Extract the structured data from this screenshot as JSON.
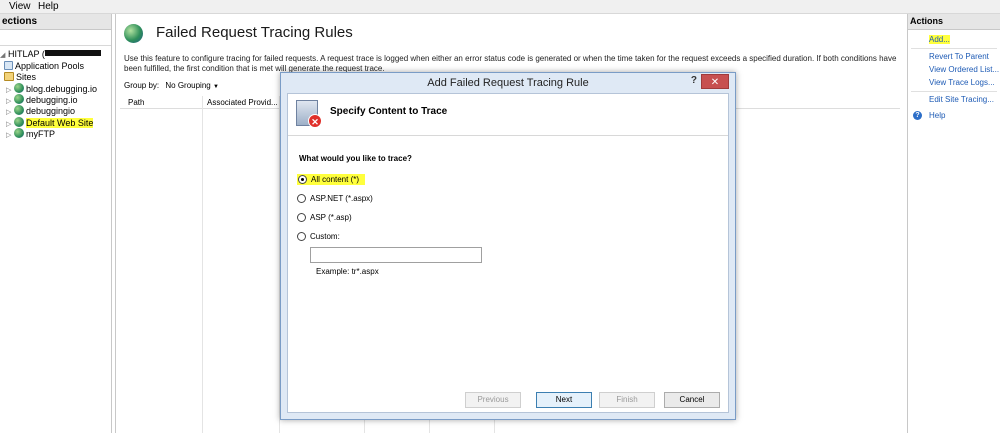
{
  "menu": {
    "view": "View",
    "help": "Help"
  },
  "left": {
    "header": "ections",
    "tree": [
      {
        "label": "HITLAP (",
        "icon": "server-icon"
      },
      {
        "label": "Application Pools",
        "icon": "app-pools-icon"
      },
      {
        "label": "Sites",
        "icon": "sites-folder-icon"
      },
      {
        "label": "blog.debugging.io",
        "icon": "globe-icon"
      },
      {
        "label": "debugging.io",
        "icon": "globe-icon"
      },
      {
        "label": "debuggingio",
        "icon": "globe-icon"
      },
      {
        "label": "Default Web Site",
        "icon": "globe-icon"
      },
      {
        "label": "myFTP",
        "icon": "globe-icon"
      }
    ]
  },
  "center": {
    "title": "Failed Request Tracing Rules",
    "description": "Use this feature to configure tracing for failed requests. A request trace is logged when either an error status code is generated or when the time taken for the request exceeds a specified duration. If both conditions have been fulfilled, the first condition that is met will generate the request trace.",
    "group_by_label": "Group by:",
    "group_by_value": "No Grouping",
    "columns": [
      "Path",
      "Associated Provid..."
    ]
  },
  "actions": {
    "header": "Actions",
    "items": [
      "Add...",
      "Revert To Parent",
      "View Ordered List...",
      "View Trace Logs...",
      "Edit Site Tracing...",
      "Help"
    ]
  },
  "dialog": {
    "title": "Add Failed Request Tracing Rule",
    "help_glyph": "?",
    "close_glyph": "✕",
    "step_title": "Specify Content to Trace",
    "question": "What would you like to trace?",
    "options": [
      "All content (*)",
      "ASP.NET (*.aspx)",
      "ASP (*.asp)",
      "Custom:"
    ],
    "selected_option": "All content (*)",
    "custom_value": "",
    "example": "Example: tr*.aspx",
    "buttons": {
      "previous": "Previous",
      "next": "Next",
      "finish": "Finish",
      "cancel": "Cancel"
    }
  },
  "colors": {
    "highlight": "#ffff3c",
    "link": "#1e5bb5",
    "close": "#c75050"
  }
}
